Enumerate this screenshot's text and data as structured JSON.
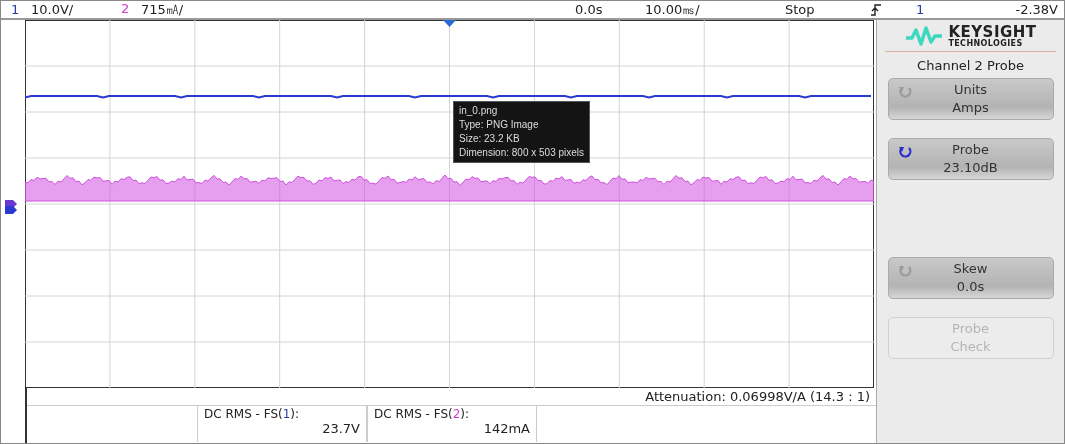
{
  "top_bar": {
    "channels": [
      {
        "number": "1",
        "scale": "10.0V/",
        "color": "#2a3aa8"
      },
      {
        "number": "2",
        "scale": "715㎃/",
        "color": "#d040d0"
      }
    ],
    "time_delay": "0.0s",
    "time_scale": "10.00㎳/",
    "run_status": "Stop",
    "trigger": {
      "channel": "1",
      "level": "-2.38V",
      "color": "#2a3aa8"
    }
  },
  "waveforms": [
    {
      "kind": "line",
      "color": "#2a3ad0"
    },
    {
      "kind": "band",
      "color": "#d050e0"
    }
  ],
  "tooltip": {
    "lines": [
      "in_0.png",
      "Type: PNG Image",
      "Size: 23.2 KB",
      "Dimension: 800 x 503 pixels"
    ]
  },
  "side_panel": {
    "logo": {
      "name": "KEYSIGHT",
      "subtitle": "TECHNOLOGIES"
    },
    "title": "Channel 2 Probe",
    "softkeys": [
      {
        "kind": "knob",
        "label": "Units",
        "value": "Amps",
        "knob_active": false
      },
      {
        "kind": "knob",
        "label": "Probe",
        "value": "23.10dB",
        "knob_active": true
      },
      {
        "kind": "spacer"
      },
      {
        "kind": "knob",
        "label": "Skew",
        "value": "0.0s",
        "knob_active": false
      },
      {
        "kind": "action",
        "label": "Probe Check",
        "disabled": true
      }
    ]
  },
  "attenuation": "Attenuation: 0.06998V/A (14.3 : 1)",
  "measurements": [
    {
      "label_before": "DC RMS - FS(",
      "source": "1",
      "label_after": "):",
      "value": "23.7V",
      "color": "#2a3aa8"
    },
    {
      "label_before": "DC RMS - FS(",
      "source": "2",
      "label_after": "):",
      "value": "142mA",
      "color": "#d040d0"
    }
  ]
}
